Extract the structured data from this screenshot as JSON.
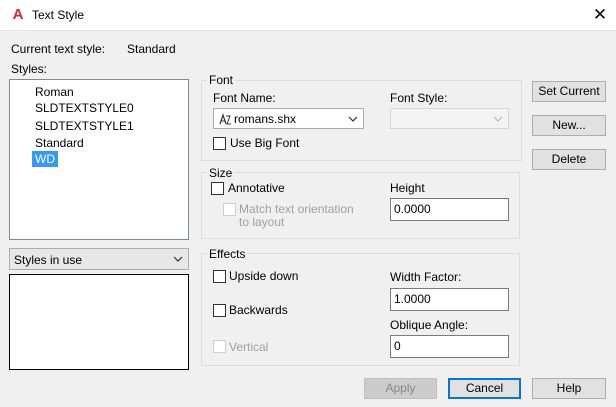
{
  "window": {
    "title": "Text Style",
    "close_glyph": "✕"
  },
  "current_style": {
    "label": "Current text style:",
    "value": "Standard"
  },
  "styles": {
    "label": "Styles:",
    "items": [
      "Roman",
      "SLDTEXTSTYLE0",
      "SLDTEXTSTYLE1",
      "Standard",
      "WD"
    ],
    "selected": "WD"
  },
  "filter": {
    "value": "Styles in use"
  },
  "font": {
    "group_label": "Font",
    "font_name_label": "Font Name:",
    "font_name_value": "romans.shx",
    "font_style_label": "Font Style:",
    "font_style_value": "",
    "use_big_font_label": "Use Big Font"
  },
  "size": {
    "group_label": "Size",
    "annotative_label": "Annotative",
    "match_line1": "Match text orientation",
    "match_line2": "to layout",
    "height_label": "Height",
    "height_value": "0.0000"
  },
  "effects": {
    "group_label": "Effects",
    "upside_down_label": "Upside down",
    "backwards_label": "Backwards",
    "vertical_label": "Vertical",
    "width_factor_label": "Width Factor:",
    "width_factor_value": "1.0000",
    "oblique_label": "Oblique Angle:",
    "oblique_value": "0"
  },
  "buttons": {
    "set_current": "Set Current",
    "new": "New...",
    "delete": "Delete",
    "apply": "Apply",
    "cancel": "Cancel",
    "help": "Help"
  },
  "colors": {
    "selection": "#3399ff",
    "app_icon": "#d6262b"
  }
}
